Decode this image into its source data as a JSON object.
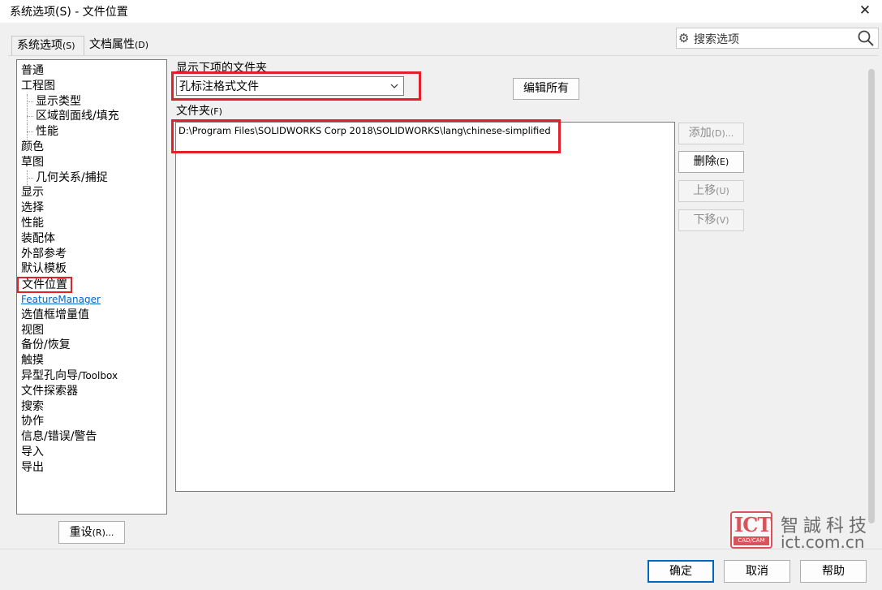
{
  "window": {
    "title": "系统选项(S) - 文件位置",
    "close_glyph": "✕"
  },
  "tabs": [
    {
      "label": "系统选项",
      "hotkey": "(S)"
    },
    {
      "label": "文档属性",
      "hotkey": "(D)"
    }
  ],
  "search": {
    "placeholder": "搜索选项",
    "icon": "search-icon"
  },
  "tree": {
    "items": [
      {
        "label": "普通",
        "level": 0
      },
      {
        "label": "工程图",
        "level": 0
      },
      {
        "label": "显示类型",
        "level": 1
      },
      {
        "label": "区域剖面线/填充",
        "level": 1
      },
      {
        "label": "性能",
        "level": 1
      },
      {
        "label": "颜色",
        "level": 0
      },
      {
        "label": "草图",
        "level": 0
      },
      {
        "label": "几何关系/捕捉",
        "level": 1
      },
      {
        "label": "显示",
        "level": 0
      },
      {
        "label": "选择",
        "level": 0
      },
      {
        "label": "性能",
        "level": 0
      },
      {
        "label": "装配体",
        "level": 0
      },
      {
        "label": "外部参考",
        "level": 0
      },
      {
        "label": "默认模板",
        "level": 0
      },
      {
        "label": "文件位置",
        "level": 0,
        "selected": true
      },
      {
        "label": "FeatureManager",
        "level": 0,
        "link": true
      },
      {
        "label": "选值框增量值",
        "level": 0
      },
      {
        "label": "视图",
        "level": 0
      },
      {
        "label": "备份/恢复",
        "level": 0
      },
      {
        "label": "触摸",
        "level": 0
      },
      {
        "label": "异型孔向导",
        "suffix": "/Toolbox",
        "level": 0
      },
      {
        "label": "文件探索器",
        "level": 0
      },
      {
        "label": "搜索",
        "level": 0
      },
      {
        "label": "协作",
        "level": 0
      },
      {
        "label": "信息/错误/警告",
        "level": 0
      },
      {
        "label": "导入",
        "level": 0
      },
      {
        "label": "导出",
        "level": 0
      }
    ]
  },
  "reset": {
    "label": "重设",
    "hotkey": "(R)..."
  },
  "folders_section": {
    "show_label": "显示下项的文件夹",
    "combo_value": "孔标注格式文件",
    "edit_all": "编辑所有",
    "folder_label": "文件夹",
    "folder_hotkey": "(F)",
    "rows": [
      "D:\\Program Files\\SOLIDWORKS Corp 2018\\SOLIDWORKS\\lang\\chinese-simplified"
    ]
  },
  "side_buttons": {
    "add": {
      "label": "添加",
      "hotkey": "(D)..."
    },
    "delete": {
      "label": "删除",
      "hotkey": "(E)"
    },
    "up": {
      "label": "上移",
      "hotkey": "(U)"
    },
    "down": {
      "label": "下移",
      "hotkey": "(V)"
    }
  },
  "watermark": {
    "logo": "ICT",
    "logo_sub": "CAD/CAM",
    "cn": "智誠科技",
    "url": "ict.com.cn"
  },
  "footer": {
    "ok": "确定",
    "cancel": "取消",
    "help": "帮助"
  },
  "colors": {
    "highlight": "#e0202a",
    "link": "#0066cc",
    "default_button": "#0067c0"
  }
}
